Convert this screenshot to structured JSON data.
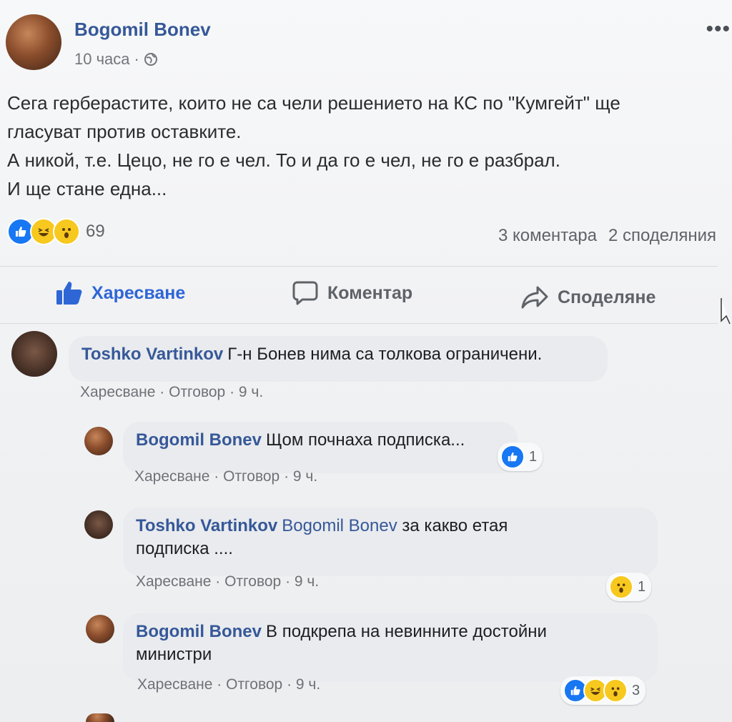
{
  "post": {
    "author": "Bogomil Bonev",
    "time": "10 часа",
    "privacy_icon": "globe-icon",
    "lines": [
      "Сега герберастите, които не са чели решението на КС по \"Кумгейт\" ще",
      "гласуват против оставките.",
      "А никой, т.е. Цецо, не го е чел. То и да го е чел, не го е разбрал.",
      "И ще стане една..."
    ],
    "reactions": [
      "like",
      "haha",
      "wow"
    ],
    "reaction_count": "69",
    "comments_count": "3 коментара",
    "shares_count": "2 споделяния"
  },
  "actions": {
    "like": "Харесване",
    "comment": "Коментар",
    "share": "Споделяне"
  },
  "comments": [
    {
      "author": "Toshko Vartinkov",
      "text": "Г-н Бонев нима са толкова ограничени.",
      "like": "Харесване",
      "reply": "Отговор",
      "time": "9 ч."
    },
    {
      "author": "Bogomil Bonev",
      "text": "Щом почнаха подписка...",
      "like": "Харесване",
      "reply": "Отговор",
      "time": "9 ч.",
      "reactions": [
        "like"
      ],
      "reaction_count": "1"
    },
    {
      "author": "Toshko Vartinkov",
      "tag": "Bogomil Bonev",
      "text": "за какво етая",
      "text2": "подписка ....",
      "like": "Харесване",
      "reply": "Отговор",
      "time": "9 ч.",
      "reactions": [
        "wow"
      ],
      "reaction_count": "1"
    },
    {
      "author": "Bogomil Bonev",
      "text": "В подкрепа на невинните достойни",
      "text2": "министри",
      "like": "Харесване",
      "reply": "Отговор",
      "time": "9 ч.",
      "reactions": [
        "like",
        "haha",
        "wow"
      ],
      "reaction_count": "3"
    }
  ],
  "meta_sep": "·"
}
